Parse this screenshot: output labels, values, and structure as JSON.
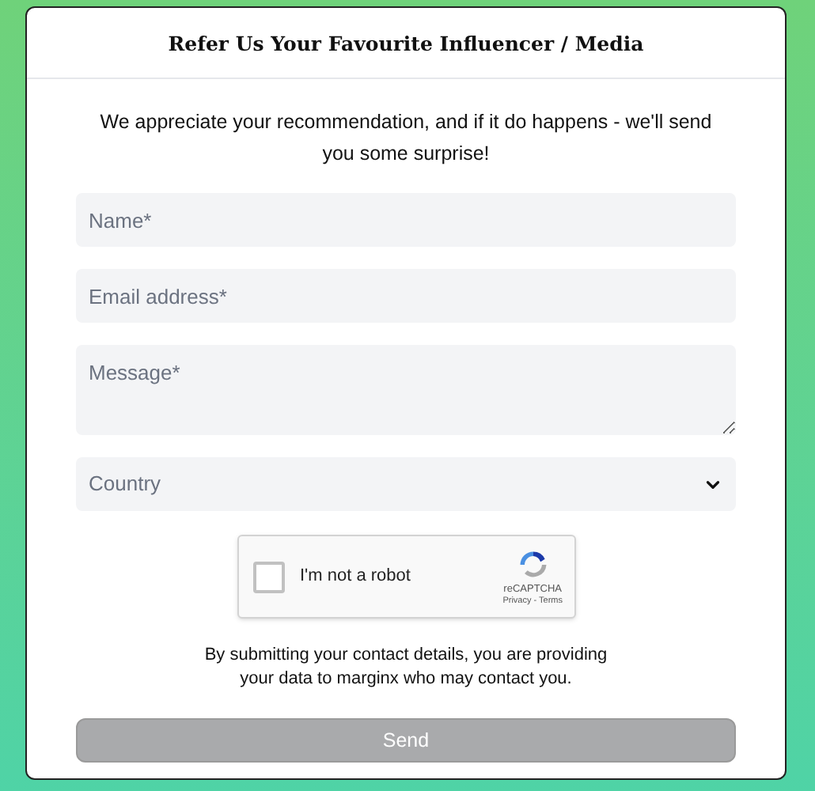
{
  "dialog": {
    "title": "Refer Us Your Favourite Influencer / Media"
  },
  "intro": "We appreciate your recommendation, and if it do happens - we'll send you some surprise!",
  "fields": [
    {
      "kind": "input",
      "placeholder": "Name*"
    },
    {
      "kind": "input",
      "placeholder": "Email address*"
    },
    {
      "kind": "textarea",
      "placeholder": "Message*"
    },
    {
      "kind": "select",
      "placeholder": "Country"
    }
  ],
  "captcha": {
    "label": "I'm not a robot",
    "checked": false,
    "brand": "reCAPTCHA",
    "links": "Privacy - Terms"
  },
  "disclaimer": "By submitting your contact details, you are providing your data to marginx who may contact you.",
  "submit": {
    "label": "Send",
    "disabled": true
  }
}
